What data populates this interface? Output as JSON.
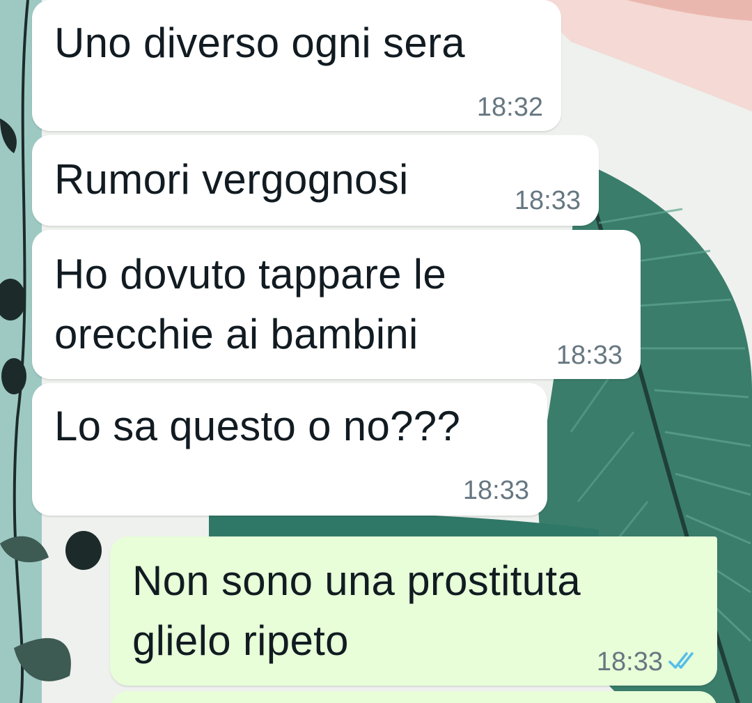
{
  "colors": {
    "incoming_bubble": "#ffffff",
    "outgoing_bubble": "#e7fed8",
    "message_text": "#111b21",
    "timestamp_text": "#667781",
    "read_ticks": "#53bdeb"
  },
  "messages": [
    {
      "direction": "incoming",
      "lines": [
        "Uno diverso ogni sera"
      ],
      "time": "18:32"
    },
    {
      "direction": "incoming",
      "lines": [
        "Rumori vergognosi"
      ],
      "time": "18:33"
    },
    {
      "direction": "incoming",
      "lines": [
        "Ho dovuto tappare le",
        "orecchie ai bambini"
      ],
      "time": "18:33"
    },
    {
      "direction": "incoming",
      "lines": [
        "Lo sa questo o no???"
      ],
      "time": "18:33"
    },
    {
      "direction": "outgoing",
      "lines": [
        "Non sono una prostituta",
        "glielo ripeto"
      ],
      "time": "18:33",
      "status_icon": "double-check-read-icon"
    }
  ]
}
